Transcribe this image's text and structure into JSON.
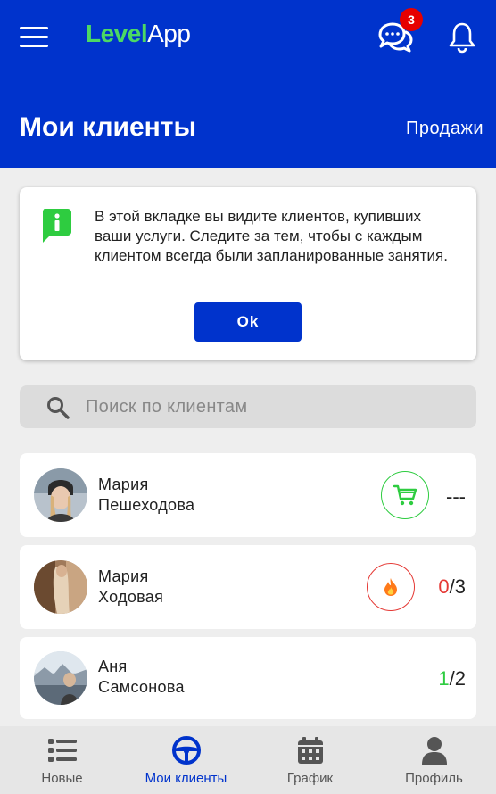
{
  "app": {
    "logo_part1": "Level",
    "logo_part2": "App",
    "chat_badge_count": "3"
  },
  "header": {
    "title": "Мои клиенты",
    "sales_link": "Продажи"
  },
  "info_card": {
    "text": "В этой вкладке вы видите клиентов, купивших ваши услуги. Следите за тем, чтобы с каждым клиентом всегда были запланированные занятия.",
    "ok_label": "Ok"
  },
  "search": {
    "placeholder": "Поиск по клиентам"
  },
  "clients": [
    {
      "first": "Мария",
      "last": "Пешеходова",
      "status_icon": "cart-icon",
      "ratio_text": "---"
    },
    {
      "first": "Мария",
      "last": "Ходовая",
      "status_icon": "fire-icon",
      "done": "0",
      "total": "/3"
    },
    {
      "first": "Аня",
      "last": "Самсонова",
      "done": "1",
      "total": "/2"
    }
  ],
  "nav": {
    "items": [
      {
        "label": "Новые",
        "icon": "list-icon"
      },
      {
        "label": "Мои клиенты",
        "icon": "steering-wheel-icon"
      },
      {
        "label": "График",
        "icon": "calendar-icon"
      },
      {
        "label": "Профиль",
        "icon": "person-icon"
      }
    ]
  },
  "colors": {
    "primary": "#0033cc",
    "accent_green": "#4cd964",
    "alert_red": "#e53935"
  }
}
